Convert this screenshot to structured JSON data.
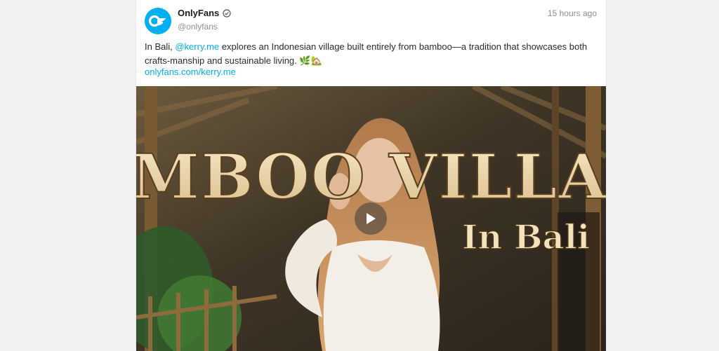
{
  "post": {
    "author_name": "OnlyFans",
    "author_handle": "@onlyfans",
    "time": "15 hours ago",
    "text_before": "In Bali, ",
    "mention": "@kerry.me",
    "text_after": " explores an Indonesian village built entirely from bamboo—a tradition that showcases both crafts-manship and sustainable living. 🌿🏡",
    "link": "onlyfans.com/kerry.me"
  },
  "media": {
    "title_line1": "BAMBOO VILLAGE",
    "title_line2": "In Bali"
  },
  "colors": {
    "brand": "#00aff0",
    "background": "#f1f2f4"
  },
  "icons": {
    "avatar": "onlyfans-logo-icon",
    "verified": "verified-badge-icon",
    "play": "play-icon"
  }
}
